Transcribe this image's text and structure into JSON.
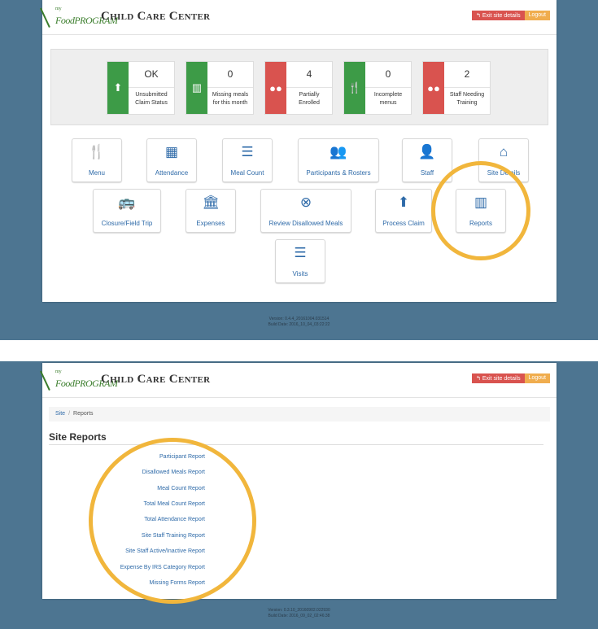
{
  "brand": {
    "logo_small": "my",
    "logo_text": "FoodPROGRAM",
    "title": "Child Care Center"
  },
  "header_buttons": {
    "exit": "↰ Exit site details",
    "logout": "Logout"
  },
  "stats": [
    {
      "value": "OK",
      "label1": "Unsubmitted",
      "label2": "Claim Status",
      "icon": "upload-icon",
      "color": "#3d9b47"
    },
    {
      "value": "0",
      "label1": "Missing meals",
      "label2": "for this month",
      "icon": "bar-chart-icon",
      "color": "#3d9b47"
    },
    {
      "value": "4",
      "label1": "Partially",
      "label2": "Enrolled",
      "icon": "group-icon",
      "color": "#d9534f"
    },
    {
      "value": "0",
      "label1": "Incomplete",
      "label2": "menus",
      "icon": "utensils-icon",
      "color": "#3d9b47"
    },
    {
      "value": "2",
      "label1": "Staff Needing",
      "label2": "Training",
      "icon": "group-icon",
      "color": "#d9534f"
    }
  ],
  "tiles": {
    "menu": "Menu",
    "attendance": "Attendance",
    "meal_count": "Meal Count",
    "participants": "Participants & Rosters",
    "staff": "Staff",
    "site_details": "Site Details",
    "closure": "Closure/Field Trip",
    "expenses": "Expenses",
    "review": "Review Disallowed Meals",
    "process_claim": "Process Claim",
    "reports": "Reports",
    "visits": "Visits"
  },
  "version_top": {
    "line1": "Version: 0.4.4_20161004.031514",
    "line2": "Build Date: 2016_10_04_03:22:22"
  },
  "breadcrumb": {
    "site": "Site",
    "current": "Reports"
  },
  "page_title": "Site Reports",
  "reports": [
    "Participant Report",
    "Disallowed Meals Report",
    "Meal Count Report",
    "Total Meal Count Report",
    "Total Attendance Report",
    "Site Staff Training Report",
    "Site Staff Active/Inactive Report",
    "Expense By IRS Category Report",
    "Missing Forms Report"
  ],
  "version_bottom": {
    "line1": "Version: 0.3.10_20160902.022930",
    "line2": "Build Date: 2016_09_02_02:46:38"
  },
  "colors": {
    "background": "#4d7591",
    "accent": "#2e6aa8",
    "highlight": "#f1b63c",
    "green": "#3d9b47",
    "red": "#d9534f"
  }
}
